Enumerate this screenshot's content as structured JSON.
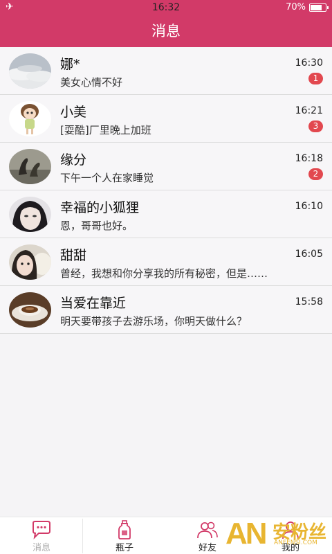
{
  "status_bar": {
    "time": "16:32",
    "battery": "70%",
    "battery_level": 0.7
  },
  "header": {
    "title": "消息"
  },
  "conversations": [
    {
      "name": "娜*",
      "preview": "美女心情不好",
      "time": "16:30",
      "unread": "1",
      "avatar": "clouds"
    },
    {
      "name": "小美",
      "preview": "[耍酷]厂里晚上加班",
      "time": "16:21",
      "unread": "3",
      "avatar": "doll"
    },
    {
      "name": "缘分",
      "preview": "下午一个人在家睡觉",
      "time": "16:18",
      "unread": "2",
      "avatar": "swans"
    },
    {
      "name": "幸福的小狐狸",
      "preview": "恩，哥哥也好。",
      "time": "16:10",
      "unread": "",
      "avatar": "girl"
    },
    {
      "name": "甜甜",
      "preview": "曾经，我想和你分享我的所有秘密，但是……",
      "time": "16:05",
      "unread": "",
      "avatar": "girl2"
    },
    {
      "name": "当爱在靠近",
      "preview": "明天要带孩子去游乐场，你明天做什么？",
      "time": "15:58",
      "unread": "",
      "avatar": "coffee"
    }
  ],
  "tabs": [
    {
      "label": "消息",
      "icon": "chat-bubble-icon"
    },
    {
      "label": "瓶子",
      "icon": "bottle-icon"
    },
    {
      "label": "好友",
      "icon": "friends-icon"
    },
    {
      "label": "我的",
      "icon": "profile-icon"
    }
  ],
  "watermark": {
    "brand": "AN",
    "cn": "安粉丝",
    "url": "ANFENSI.COM"
  },
  "colors": {
    "accent": "#d23a68",
    "badge": "#e2484f"
  }
}
